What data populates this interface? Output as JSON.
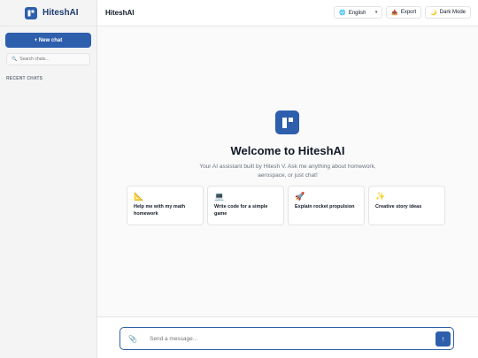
{
  "brand": {
    "name": "HiteshAI"
  },
  "sidebar": {
    "new_chat_label": "+ New chat",
    "search_placeholder": "Search chats...",
    "recent_label": "RECENT CHATS"
  },
  "header": {
    "title": "HiteshAI",
    "language": {
      "selected": "English"
    },
    "export_label": "Export",
    "dark_mode_label": "Dark Mode"
  },
  "welcome": {
    "title": "Welcome to HiteshAI",
    "subtitle": "Your AI assistant built by Hitesh V. Ask me anything about homework, aerospace, or just chat!"
  },
  "suggestions": [
    {
      "icon": "ruler-icon",
      "glyph": "📐",
      "text": "Help me with my math homework"
    },
    {
      "icon": "laptop-icon",
      "glyph": "💻",
      "text": "Write code for a simple game"
    },
    {
      "icon": "rocket-icon",
      "glyph": "🚀",
      "text": "Explain rocket propulsion"
    },
    {
      "icon": "sparkles-icon",
      "glyph": "✨",
      "text": "Creative story ideas"
    }
  ],
  "composer": {
    "placeholder": "Send a message...",
    "attach_glyph": "📎",
    "send_glyph": "↑"
  },
  "colors": {
    "accent": "#2d5fad",
    "sidebar_bg": "#f4f4f5",
    "main_bg": "#fafafa"
  }
}
